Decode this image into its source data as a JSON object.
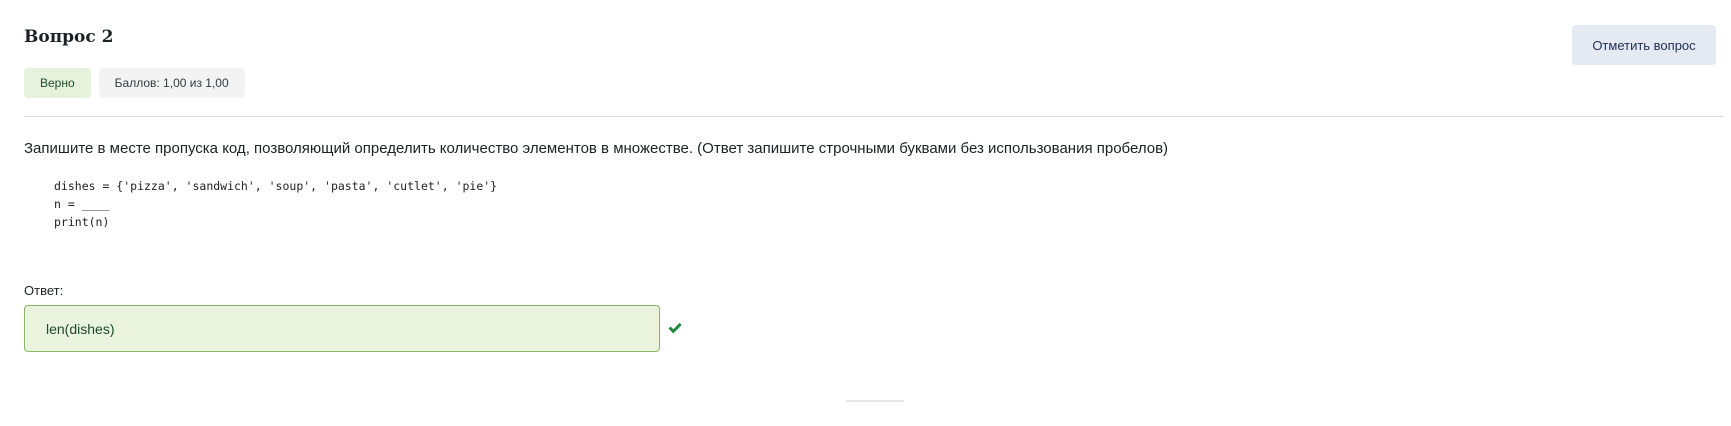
{
  "question": {
    "title": "Вопрос 2",
    "status_badge": "Верно",
    "grade_badge": "Баллов: 1,00 из 1,00",
    "flag_button": "Отметить вопрос",
    "text": "Запишите в месте пропуска код, позволяющий определить количество элементов в множестве. (Ответ запишите строчными буквами без использования пробелов)",
    "code_lines": [
      "dishes = {'pizza', 'sandwich', 'soup', 'pasta', 'cutlet', 'pie'}",
      "n = ____",
      "print(n)"
    ]
  },
  "answer": {
    "label": "Ответ:",
    "value": "len(dishes)",
    "status_icon": "check-icon"
  },
  "colors": {
    "correct_bg": "#e6f2dc",
    "correct_border": "#88b666",
    "check_green": "#1e8a3a",
    "flag_button_bg": "#e5e9f1"
  }
}
